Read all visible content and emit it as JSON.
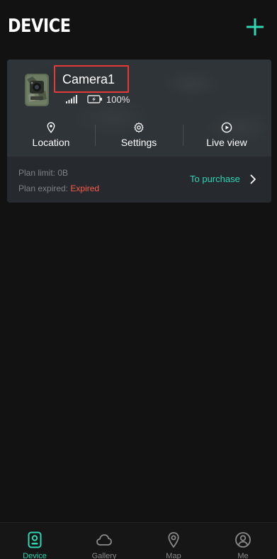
{
  "header": {
    "title": "DEVICE",
    "add_icon": "plus-icon"
  },
  "device_card": {
    "name": "Camera1",
    "signal_icon": "signal-bars-icon",
    "battery_icon": "battery-charging-icon",
    "battery_percent": "100%",
    "actions": [
      {
        "label": "Location",
        "icon": "location-pin-icon"
      },
      {
        "label": "Settings",
        "icon": "gear-icon"
      },
      {
        "label": "Live view",
        "icon": "play-circle-icon"
      }
    ],
    "plan_limit": "Plan limit: 0B",
    "plan_expired_label": "Plan expired: ",
    "plan_expired_value": "Expired",
    "purchase_label": "To purchase"
  },
  "tabbar": {
    "tabs": [
      {
        "label": "Device",
        "icon": "camera-device-icon",
        "active": true
      },
      {
        "label": "Gallery",
        "icon": "cloud-icon",
        "active": false
      },
      {
        "label": "Map",
        "icon": "map-pin-icon",
        "active": false
      },
      {
        "label": "Me",
        "icon": "user-icon",
        "active": false
      }
    ]
  },
  "colors": {
    "accent": "#2fd6b4",
    "expired": "#ff5b4a",
    "highlight_box": "#e53935",
    "background": "#121212"
  }
}
